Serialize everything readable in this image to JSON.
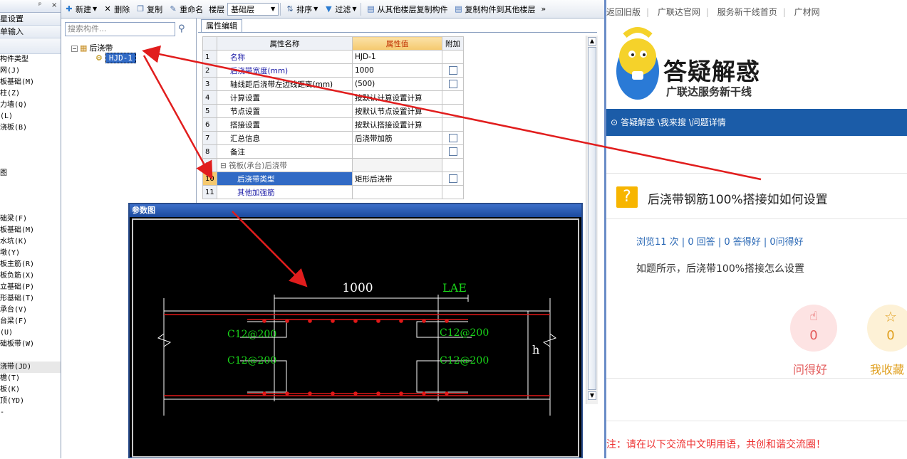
{
  "left_panel": {
    "header_buttons": [
      "ᵖ",
      "×"
    ],
    "rows": [
      "星设置",
      "单输入"
    ],
    "items": [
      {
        "label": "构件类型",
        "selected": false
      },
      {
        "label": "网(J)",
        "selected": false
      },
      {
        "label": "板基础(M)",
        "selected": false
      },
      {
        "label": "柱(Z)",
        "selected": false
      },
      {
        "label": "力墙(Q)",
        "selected": false
      },
      {
        "label": "(L)",
        "selected": false
      },
      {
        "label": "浇板(B)",
        "selected": false
      },
      {
        "label": "",
        "selected": false
      },
      {
        "label": "",
        "selected": false
      },
      {
        "label": "",
        "selected": false
      },
      {
        "label": "图",
        "selected": false
      },
      {
        "label": "",
        "selected": false
      },
      {
        "label": "",
        "selected": false
      },
      {
        "label": "",
        "selected": false
      },
      {
        "label": "础梁(F)",
        "selected": false
      },
      {
        "label": "板基础(M)",
        "selected": false
      },
      {
        "label": "水坑(K)",
        "selected": false
      },
      {
        "label": "墩(Y)",
        "selected": false
      },
      {
        "label": "板主筋(R)",
        "selected": false
      },
      {
        "label": "板负筋(X)",
        "selected": false
      },
      {
        "label": "立基础(P)",
        "selected": false
      },
      {
        "label": "形基础(T)",
        "selected": false
      },
      {
        "label": "承台(V)",
        "selected": false
      },
      {
        "label": "台梁(F)",
        "selected": false
      },
      {
        "label": "(U)",
        "selected": false
      },
      {
        "label": "础板带(W)",
        "selected": false
      },
      {
        "label": "",
        "selected": false
      },
      {
        "label": "浇带(JD)",
        "selected": true
      },
      {
        "label": "檐(T)",
        "selected": false
      },
      {
        "label": "板(K)",
        "selected": false
      },
      {
        "label": "顶(YD)",
        "selected": false
      },
      {
        "label": "-",
        "selected": false
      }
    ]
  },
  "toolbar": {
    "new": "新建",
    "delete": "删除",
    "copy": "复制",
    "rename": "重命名",
    "floor_label": "楼层",
    "floor_value": "基础层",
    "sort": "排序",
    "filter": "过滤",
    "copy_from_floor": "从其他楼层复制构件",
    "copy_to_floor": "复制构件到其他楼层",
    "more": "»"
  },
  "tree": {
    "search_placeholder": "搜索构件...",
    "root": "后浇带",
    "child": "HJD-1"
  },
  "props": {
    "tab": "属性编辑",
    "col_name": "属性名称",
    "col_value": "属性值",
    "col_add": "附加",
    "rows": [
      {
        "n": "1",
        "name": "名称",
        "value": "HJD-1",
        "blue": true,
        "check": false
      },
      {
        "n": "2",
        "name": "后浇带宽度(mm)",
        "value": "1000",
        "blue": true,
        "check": true
      },
      {
        "n": "3",
        "name": "轴线距后浇带左边线距离(mm)",
        "value": "(500)",
        "blue": false,
        "check": true
      },
      {
        "n": "4",
        "name": "计算设置",
        "value": "按默认计算设置计算",
        "blue": false,
        "check": false
      },
      {
        "n": "5",
        "name": "节点设置",
        "value": "按默认节点设置计算",
        "blue": false,
        "check": false
      },
      {
        "n": "6",
        "name": "搭接设置",
        "value": "按默认搭接设置计算",
        "blue": false,
        "check": false
      },
      {
        "n": "7",
        "name": "汇总信息",
        "value": "后浇带加筋",
        "blue": false,
        "check": true
      },
      {
        "n": "8",
        "name": "备注",
        "value": "",
        "blue": false,
        "check": true
      },
      {
        "n": "9",
        "name": "筏板(承台)后浇带",
        "value": "",
        "blue": false,
        "check": false
      },
      {
        "n": "10",
        "name": "后浇带类型",
        "value": "矩形后浇带",
        "blue": false,
        "check": true
      },
      {
        "n": "11",
        "name": "其他加强筋",
        "value": "",
        "blue": true,
        "check": false
      }
    ]
  },
  "dialog": {
    "title": "参数图",
    "dim_width": "1000",
    "dim_lae": "LAE",
    "rebar_top_left": "C12@200",
    "rebar_bottom_left": "C12@200",
    "rebar_top_right": "C12@200",
    "rebar_bottom_right": "C12@200",
    "height_label": "h"
  },
  "right": {
    "links": [
      "返回旧版",
      "广联达官网",
      "服务新干线首页",
      "广材网"
    ],
    "logo_title": "答疑解惑",
    "logo_subtitle": "广联达服务新干线",
    "breadcrumb": "答疑解惑 \\我来搜 \\问题详情",
    "question": "后浇带钢筋100%搭接如如何设置",
    "stats": "浏览11 次 | 0 回答 | 0 答得好 | 0问得好",
    "body": "如题所示，后浇带100%搭接怎么设置",
    "good_count": "0",
    "good_label": "问得好",
    "fav_count": "0",
    "fav_label": "我收藏",
    "notice": "注：请在以下交流中文明用语，共创和谐交流圈！"
  },
  "colors": {
    "accent": "#1b5ca8",
    "arrow": "#e11d1d",
    "green": "#19d619",
    "rebar": "#e01818"
  }
}
